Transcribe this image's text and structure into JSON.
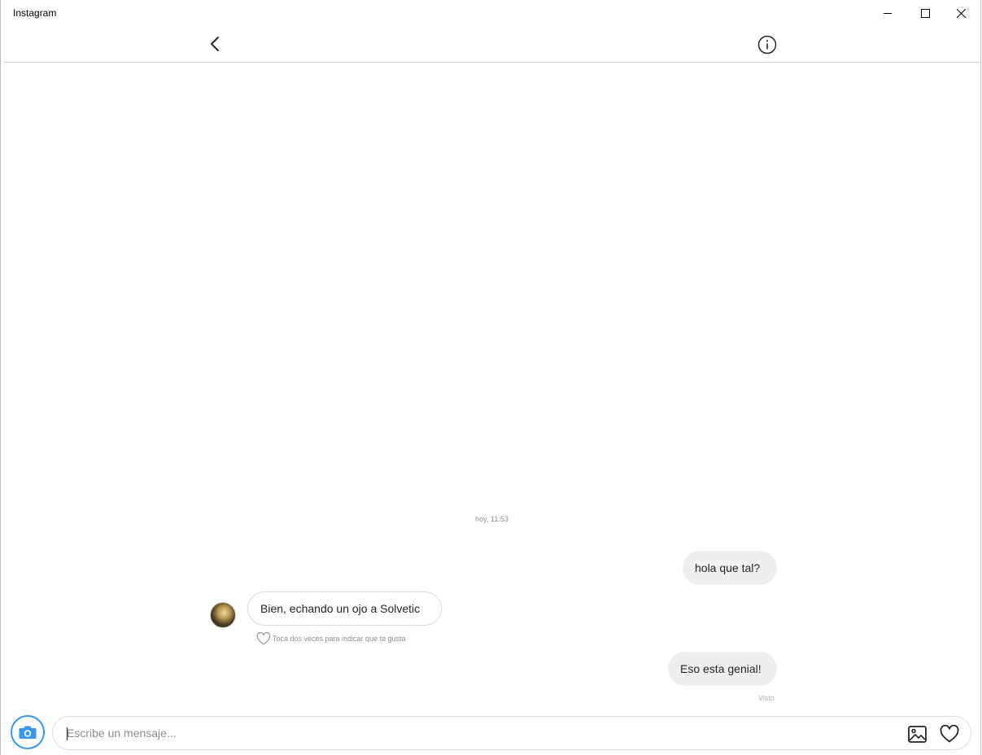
{
  "window": {
    "title": "Instagram"
  },
  "header": {
    "back_icon": "chevron-left-icon",
    "info_icon": "info-icon"
  },
  "chat": {
    "timestamp": "hoy, 11:53",
    "messages": [
      {
        "direction": "outgoing",
        "text": "hola que tal?"
      },
      {
        "direction": "incoming",
        "text": "Bien, echando un ojo a Solvetic"
      },
      {
        "direction": "outgoing",
        "text": "Eso esta genial!"
      }
    ],
    "like_hint": "Toca dos veces para indicar que te gusta",
    "seen_status": "Visto"
  },
  "composer": {
    "placeholder": "Escribe un mensaje...",
    "camera_icon": "camera-icon",
    "gallery_icon": "image-icon",
    "heart_icon": "heart-icon"
  },
  "colors": {
    "accent": "#3897f0",
    "outgoing_bubble": "#efefef",
    "muted_text": "#8e8e8e"
  }
}
